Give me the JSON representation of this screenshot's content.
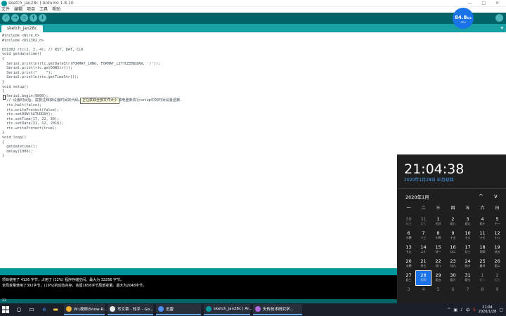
{
  "window": {
    "title": "sketch_jan28c | Arduino 1.8.10",
    "controls": "— □ ✕"
  },
  "menu": [
    "文件",
    "编辑",
    "项目",
    "工具",
    "帮助"
  ],
  "toolbar": {
    "verify": "✓",
    "upload": "→",
    "new": "▫",
    "open": "↑",
    "save": "↓",
    "serial": ""
  },
  "tab": {
    "name": "sketch_jan28c",
    "menu": "▾"
  },
  "code": [
    "#include <Wire.h>",
    "#include <DS1302.h>",
    "",
    "DS1302 rtc(2, 3, 4); // RST, DAT, CLK",
    "void getdatetime()",
    "{",
    "  Serial.println(rtc.getDateStr(FORMAT_LONG, FORMAT_LITTLEENDIAN, '/'));",
    "  Serial.print(rtc.getDOWStr());",
    "  Serial.print(\"    \");",
    "  Serial.println(rtc.getTimeStr());",
    "}",
    "void setup()",
    "{",
    "  Serial.begin(9600);",
    "  // 设置时间后，需要注释掉设置时间的代码,并重新烧录一次. 以免掉电重新执行setup中的时间设置函数.",
    "  rtc.halt(false);",
    "  rtc.writeProtect(false);",
    "  rtc.setDOW(SATURDAY);",
    "  rtc.setTime(17, 22, 30);",
    "  rtc.setDate(31, 12, 2016);",
    "  rtc.writeProtect(true);",
    "}",
    "void loop()",
    "{",
    "  getdatetime();",
    "  delay(1000);",
    "}"
  ],
  "tooltip": "正在获取全部文件大小",
  "console": [
    "项目使用了 4126 字节，占用了 (12%) 程序存储空间。最大为 32256 字节。",
    "全局变量使用了392字节，(19%)的动态内存，余留1656字节局部变量。最大为2048字节。"
  ],
  "status": "22",
  "net_widget": {
    "value": "84.8",
    "unit": "k/s",
    "sub": "CPU"
  },
  "taskbar": {
    "tasks": [
      {
        "label": "W:\\视频\\Snow-R...",
        "color": "#f2b12f"
      },
      {
        "label": "写文章 - 知乎 - Go...",
        "color": "#e8e8e8"
      },
      {
        "label": "迅雷",
        "color": "#4d8ef5"
      },
      {
        "label": "sketch_jan28c | Ar...",
        "color": "#00979c"
      },
      {
        "label": "失传技术研究学...",
        "color": "#b36be0"
      }
    ],
    "tray": [
      "^",
      "▣",
      "♪",
      "中",
      "S"
    ],
    "time": "21:04",
    "date": "2020/1/28"
  },
  "calendar": {
    "time": "21:04:38",
    "date_line": "2020年1月28日 正月初四",
    "month": "2020年1月",
    "prev": "^",
    "next": "v",
    "weekdays": [
      "一",
      "二",
      "三",
      "四",
      "五",
      "六",
      "日"
    ],
    "days": [
      {
        "d": "30",
        "l": "初五",
        "dim": true
      },
      {
        "d": "31",
        "l": "初六",
        "dim": true
      },
      {
        "d": "1",
        "l": "元旦"
      },
      {
        "d": "2",
        "l": "初八"
      },
      {
        "d": "3",
        "l": "初九"
      },
      {
        "d": "4",
        "l": "初十"
      },
      {
        "d": "5",
        "l": "十一"
      },
      {
        "d": "6",
        "l": "小寒"
      },
      {
        "d": "7",
        "l": "十三"
      },
      {
        "d": "8",
        "l": "十四"
      },
      {
        "d": "9",
        "l": "十五"
      },
      {
        "d": "10",
        "l": "十六"
      },
      {
        "d": "11",
        "l": "十七"
      },
      {
        "d": "12",
        "l": "十八"
      },
      {
        "d": "13",
        "l": "十九"
      },
      {
        "d": "14",
        "l": "二十"
      },
      {
        "d": "15",
        "l": "廿一"
      },
      {
        "d": "16",
        "l": "廿二"
      },
      {
        "d": "17",
        "l": "廿三"
      },
      {
        "d": "18",
        "l": "廿四"
      },
      {
        "d": "19",
        "l": "廿五"
      },
      {
        "d": "20",
        "l": "大寒"
      },
      {
        "d": "21",
        "l": "廿七"
      },
      {
        "d": "22",
        "l": "廿八"
      },
      {
        "d": "23",
        "l": "廿九"
      },
      {
        "d": "24",
        "l": "除夕"
      },
      {
        "d": "25",
        "l": "春节"
      },
      {
        "d": "26",
        "l": "初二"
      },
      {
        "d": "27",
        "l": "初三"
      },
      {
        "d": "28",
        "l": "初四",
        "today": true
      },
      {
        "d": "29",
        "l": "初五"
      },
      {
        "d": "30",
        "l": "初六"
      },
      {
        "d": "31",
        "l": "初七"
      },
      {
        "d": "1",
        "l": "初八",
        "dim": true
      },
      {
        "d": "2",
        "l": "初九",
        "dim": true
      },
      {
        "d": "3",
        "l": "",
        "dim": true
      },
      {
        "d": "4",
        "l": "",
        "dim": true
      },
      {
        "d": "5",
        "l": "",
        "dim": true
      },
      {
        "d": "6",
        "l": "",
        "dim": true
      },
      {
        "d": "7",
        "l": "",
        "dim": true
      },
      {
        "d": "8",
        "l": "",
        "dim": true
      },
      {
        "d": "9",
        "l": "",
        "dim": true
      }
    ]
  }
}
